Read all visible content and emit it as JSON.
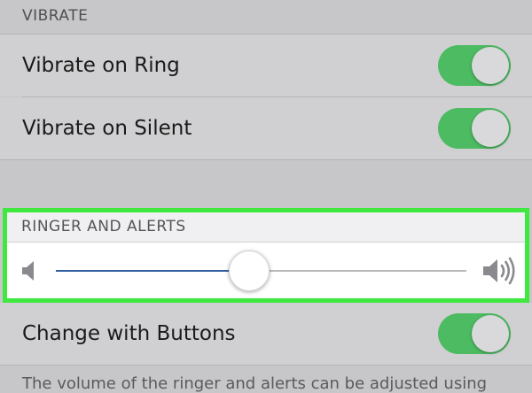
{
  "vibrate_section": {
    "header": "VIBRATE",
    "rows": [
      {
        "label": "Vibrate on Ring",
        "toggle_on": true
      },
      {
        "label": "Vibrate on Silent",
        "toggle_on": true
      }
    ]
  },
  "ringer_section": {
    "header": "RINGER AND ALERTS",
    "volume_level": 0.47,
    "icons": {
      "min": "speaker-low-icon",
      "max": "speaker-high-icon"
    }
  },
  "change_with_buttons": {
    "label": "Change with Buttons",
    "toggle_on": true
  },
  "footer": {
    "text": "The volume of the ringer and alerts can be adjusted using"
  },
  "colors": {
    "toggle_on": "#4cbb61",
    "highlight_border": "#3fe83f",
    "slider_fill": "#2f5f9e",
    "background": "#c7c7c9"
  }
}
